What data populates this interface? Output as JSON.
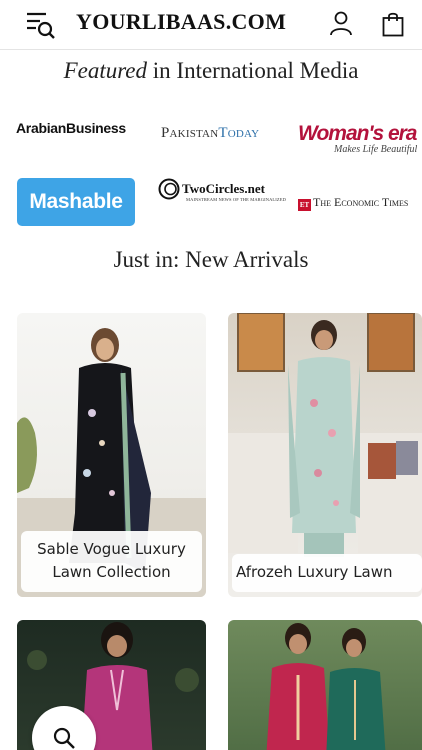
{
  "header": {
    "brand": "YOURLIBAAS.COM",
    "menu_icon": "menu-search-icon",
    "account_icon": "user-icon",
    "bag_icon": "shopping-bag-icon"
  },
  "featured": {
    "italic": "Featured",
    "rest": " in International Media"
  },
  "media_logos": {
    "arabian_business": "ArabianBusiness",
    "pakistan": "Pakistan",
    "today": "Today",
    "womans_era": "Woman's era",
    "womans_era_tagline": "Makes Life Beautiful",
    "mashable": "Mashable",
    "twocircles": "TwoCircles.net",
    "twocircles_tagline": "MAINSTREAM NEWS OF THE MARGINALIZED",
    "economic_times": "The Economic Times"
  },
  "new_arrivals": {
    "title": "Just in: New Arrivals",
    "products": [
      {
        "name": "Sable Vogue Luxury Lawn Collection"
      },
      {
        "name": "Afrozeh Luxury Lawn"
      }
    ]
  },
  "colors": {
    "mashable_blue": "#3ea4e6",
    "womans_era_red": "#b3123c",
    "pakistan_today_blue": "#2c6fa8"
  },
  "floating_search_icon": "search-icon"
}
